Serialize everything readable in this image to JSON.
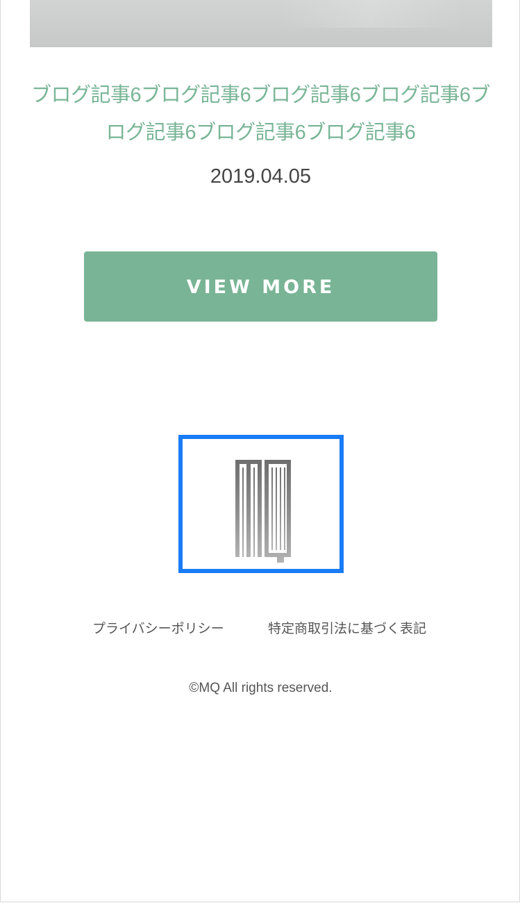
{
  "post": {
    "title": "ブログ記事6ブログ記事6ブログ記事6ブログ記事6ブログ記事6ブログ記事6ブログ記事6",
    "date": "2019.04.05"
  },
  "view_more_label": "VIEW MORE",
  "logo": {
    "text": "MQ",
    "border_color": "#1a7cf6"
  },
  "footer": {
    "links": [
      {
        "label": "プライバシーポリシー"
      },
      {
        "label": "特定商取引法に基づく表記"
      }
    ],
    "copyright": "©MQ All rights reserved."
  },
  "colors": {
    "accent": "#78b495",
    "title": "#79b596",
    "text": "#444444"
  }
}
